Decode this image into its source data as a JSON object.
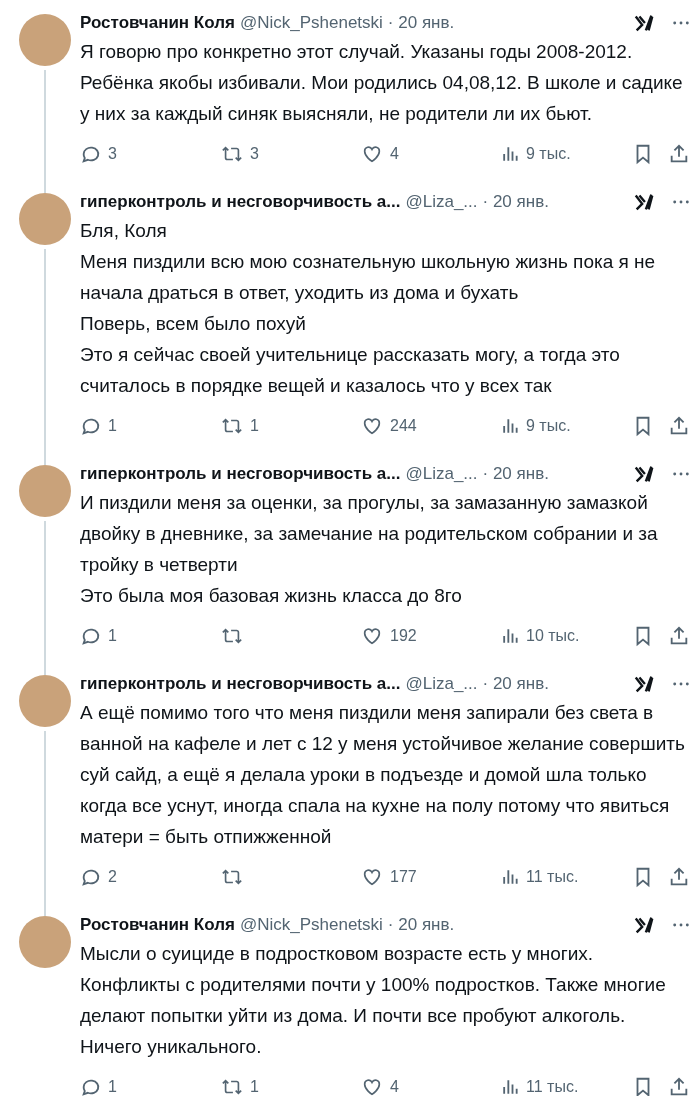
{
  "tweets": [
    {
      "name": "Ростовчанин Коля",
      "handle": "@Nick_Pshenetski",
      "date": "· 20 янв.",
      "text": "Я говорю про конкретно этот случай. Указаны годы 2008-2012. Ребёнка якобы избивали. Мои родились 04,08,12. В школе и садике у них за каждый синяк выясняли, не родители ли их бьют.",
      "replies": "3",
      "reposts": "3",
      "likes": "4",
      "views": "9 тыс."
    },
    {
      "name": "гиперконтроль и несговорчивость а...",
      "handle": "@Liza_...",
      "date": "· 20 янв.",
      "text": "Бля, Коля\nМеня пиздили всю мою сознательную школьную жизнь пока я не начала драться в ответ, уходить из дома и бухать\nПоверь, всем было похуй\nЭто я сейчас своей учительнице рассказать могу, а тогда это считалось в порядке вещей и казалось что у всех так",
      "replies": "1",
      "reposts": "1",
      "likes": "244",
      "views": "9 тыс."
    },
    {
      "name": "гиперконтроль и несговорчивость а...",
      "handle": "@Liza_...",
      "date": "· 20 янв.",
      "text": "И пиздили меня за оценки, за прогулы, за замазанную замазкой двойку в дневнике, за замечание на родительском собрании и за тройку в четверти\nЭто была моя базовая жизнь класса до 8го",
      "replies": "1",
      "likes": "192",
      "views": "10 тыс."
    },
    {
      "name": "гиперконтроль и несговорчивость а...",
      "handle": "@Liza_...",
      "date": "· 20 янв.",
      "text": "А ещё помимо того что меня пиздили меня запирали без света в ванной на кафеле и лет с 12 у меня устойчивое желание совершить суй сайд, а ещё я делала уроки в подъезде и домой шла только когда все уснут, иногда спала на кухне на полу потому что явиться матери = быть отпижженной",
      "replies": "2",
      "likes": "177",
      "views": "11 тыс."
    },
    {
      "name": "Ростовчанин Коля",
      "handle": "@Nick_Pshenetski",
      "date": "· 20 янв.",
      "text": "Мысли о суициде в подростковом возрасте есть у многих. Конфликты с родителями почти у 100% подростков. Также многие делают попытки уйти из дома. И почти все пробуют алкоголь. Ничего уникального.",
      "replies": "1",
      "reposts": "1",
      "likes": "4",
      "views": "11 тыс."
    }
  ]
}
